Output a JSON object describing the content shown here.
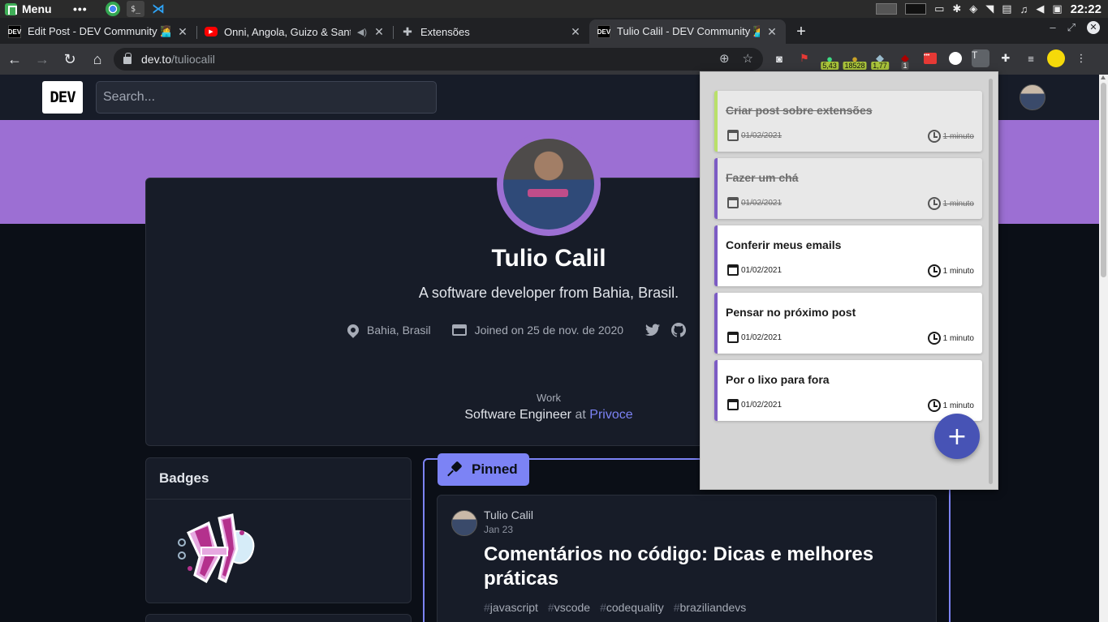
{
  "os_panel": {
    "menu_label": "Menu",
    "dots": "•••",
    "clock": "22:22"
  },
  "tabs": [
    {
      "title": "Edit Post - DEV Community 👩‍💻",
      "favicon": "dev-favicon"
    },
    {
      "title": "Onni, Angola, Guizo & Sant",
      "favicon": "youtube-favicon"
    },
    {
      "title": "Extensões",
      "favicon": "puzzle-icon"
    },
    {
      "title": "Tulio Calil - DEV Community 👩‍💻",
      "favicon": "dev-favicon",
      "active": true
    }
  ],
  "toolbar": {
    "url_host": "dev.to",
    "url_path": "/tuliocalil",
    "extension_badges": [
      "5,43",
      "18528",
      "1,77",
      "1"
    ],
    "ext_t_label": "T"
  },
  "dev": {
    "logo": "DEV",
    "search_placeholder": "Search...",
    "profile": {
      "name": "Tulio Calil",
      "bio": "A software developer from Bahia, Brasil.",
      "location": "Bahia, Brasil",
      "joined": "Joined on 25 de nov. de 2020",
      "work_label": "Work",
      "work_role": "Software Engineer",
      "work_at": "at",
      "work_company": "Privoce"
    },
    "badges_title": "Badges",
    "pinned_label": "Pinned",
    "article": {
      "author": "Tulio Calil",
      "date": "Jan 23",
      "title": "Comentários no código: Dicas e melhores práticas",
      "tags": [
        "javascript",
        "vscode",
        "codequality",
        "braziliandevs"
      ]
    }
  },
  "popup": {
    "tasks": [
      {
        "title": "Criar post sobre extensões",
        "date": "01/02/2021",
        "duration": "1 minuto",
        "done": true
      },
      {
        "title": "Fazer um chá",
        "date": "01/02/2021",
        "duration": "1 minuto",
        "done": true
      },
      {
        "title": "Conferir meus emails",
        "date": "01/02/2021",
        "duration": "1 minuto",
        "done": false
      },
      {
        "title": "Pensar no próximo post",
        "date": "01/02/2021",
        "duration": "1 minuto",
        "done": false
      },
      {
        "title": "Por o lixo para fora",
        "date": "01/02/2021",
        "duration": "1 minuto",
        "done": false
      }
    ],
    "fab_label": "+"
  },
  "colors": {
    "banner": "#9c6fd3",
    "accent": "#7c83f5",
    "fab": "#4753b5",
    "done_green": "#b9e06a"
  }
}
